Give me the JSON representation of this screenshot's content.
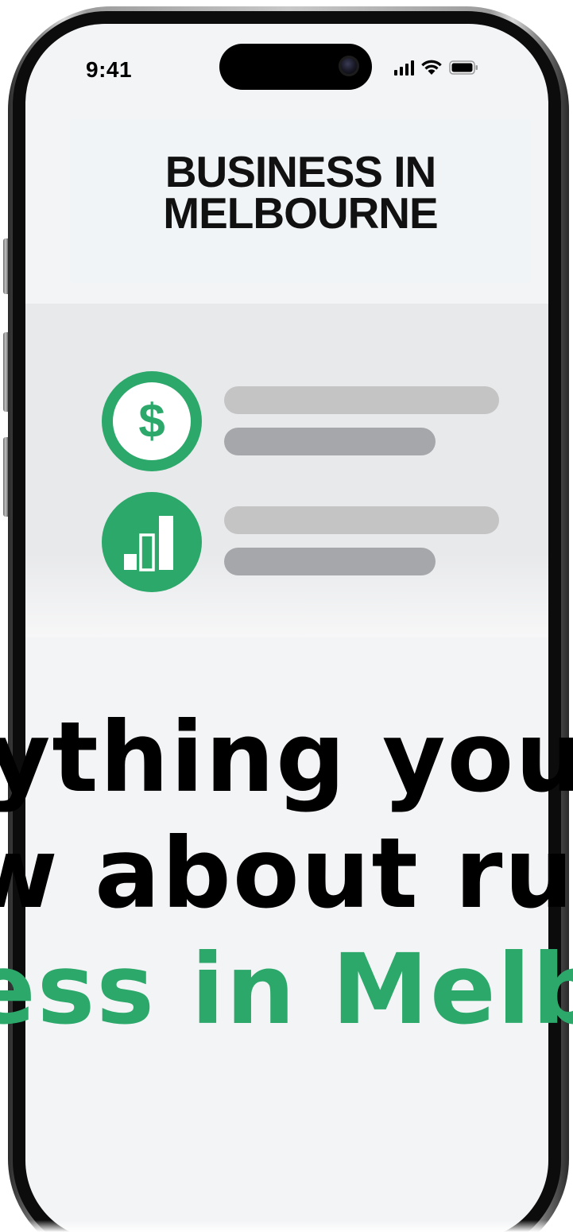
{
  "status_bar": {
    "time": "9:41",
    "icons": [
      "signal-icon",
      "wifi-icon",
      "battery-icon"
    ]
  },
  "header": {
    "title": "BUSINESS IN\nMELBOURNE"
  },
  "content": {
    "rows": [
      {
        "icon": "dollar-icon",
        "glyph": "$"
      },
      {
        "icon": "bar-chart-icon"
      }
    ]
  },
  "hero": {
    "line1": "ything you",
    "line2": "w about rur",
    "line3": "ess in Melb"
  },
  "colors": {
    "accent": "#2ba86a",
    "panel": "#e8e9eb",
    "line_light": "#c4c4c5",
    "line_dark": "#a6a7aa"
  }
}
